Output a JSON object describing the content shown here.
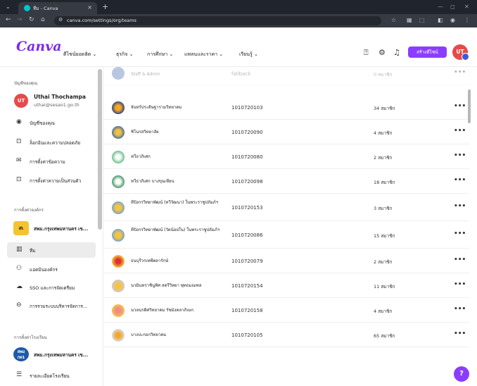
{
  "browser": {
    "tab_title": "ทีม - Canva",
    "url": "canva.com/settings/org/teams",
    "new_tab_glyph": "+",
    "close_glyph": "×"
  },
  "header": {
    "logo": "Canva",
    "nav": [
      {
        "label": "ดีไซน์ยอดฮิต ⌄"
      },
      {
        "label": "ธุรกิจ ⌄"
      },
      {
        "label": "การศึกษา ⌄"
      },
      {
        "label": "แพลนและราคา ⌄"
      },
      {
        "label": "เรียนรู้ ⌄"
      }
    ],
    "create_button": "สร้างดีไซน์",
    "avatar_initials": "UT"
  },
  "sidebar": {
    "account_section": "บัญชีของคุณ",
    "user_name": "Uthai Thochampa",
    "user_email": "uthai@sesao1.go.th",
    "user_initials": "UT",
    "account_items": [
      {
        "icon": "user-circle-icon",
        "label": "บัญชีของคุณ"
      },
      {
        "icon": "lock-icon",
        "label": "ล็อกอินและความปลอดภัย"
      },
      {
        "icon": "mail-icon",
        "label": "การตั้งค่าข้อความ"
      },
      {
        "icon": "privacy-lock-icon",
        "label": "การตั้งค่าความเป็นส่วนตัว"
      }
    ],
    "org_section": "การตั้งค่าองค์กร",
    "org_team_tile": "สเ",
    "org_team_name": "สพม.กรุงเทพมหานคร เข...",
    "org_items": [
      {
        "icon": "team-icon",
        "label": "ทีม"
      },
      {
        "icon": "add-people-icon",
        "label": "แอดมินองค์กร"
      },
      {
        "icon": "cloud-icon",
        "label": "SSO และการจัดเตรียม"
      },
      {
        "icon": "manage-icon",
        "label": "การรวมระบบบริหารจัดการ..."
      }
    ],
    "school_section": "การตั้งค่าโรงเรียน",
    "school_tile": "สพม กท1",
    "school_name": "สพม.กรุงเทพมหานคร เข...",
    "school_items": [
      {
        "icon": "list-icon",
        "label": "รายละเอียดโรงเรียน"
      }
    ]
  },
  "teams": [
    {
      "name": "Staff & Admin",
      "id": "fallback",
      "members": "0 สมาชิก",
      "faded": true
    },
    {
      "name": "จันทร์ประดิษฐารามวิทยาคม",
      "id": "1010720103",
      "members": "34 สมาชิก"
    },
    {
      "name": "ชิโนรสวิทยาลัย",
      "id": "1010720090",
      "members": "4 สมาชิก"
    },
    {
      "name": "ทวีธาภิเศก",
      "id": "1010720080",
      "members": "2 สมาชิก"
    },
    {
      "name": "ทวีธาภิเศก บางขุนเทียน",
      "id": "1010720098",
      "members": "18 สมาชิก"
    },
    {
      "name": "ทีปังกรวิทยาพัฒน์ (ทวีวัฒนา) ในพระราชูปถัมภ์ฯ",
      "id": "1010720153",
      "members": "3 สมาชิก"
    },
    {
      "name": "ทีปังกรวิทยาพัฒน์ (วัดน้อยใน) ในพระราชูปถัมภ์ฯ",
      "id": "1010720086",
      "members": "15 สมาชิก"
    },
    {
      "name": "ธนบุรีวรเทพีพลารักษ์",
      "id": "1010720079",
      "members": "2 สมาชิก"
    },
    {
      "name": "นวมินทราชินูทิศ สตรีวิทยา พุทธมณฑล",
      "id": "1010720154",
      "members": "11 สมาชิก"
    },
    {
      "name": "นวลนรดิศวิทยาคม รัชมังคลาภิเษก",
      "id": "1010720158",
      "members": "4 สมาชิก"
    },
    {
      "name": "บางปะกอกวิทยาคม",
      "id": "1010720105",
      "members": "65 สมาชิก"
    }
  ],
  "more_glyph": "•••",
  "help_label": "?",
  "colors": {
    "accent": "#8b3dff",
    "avatar": "#e64a4a"
  }
}
